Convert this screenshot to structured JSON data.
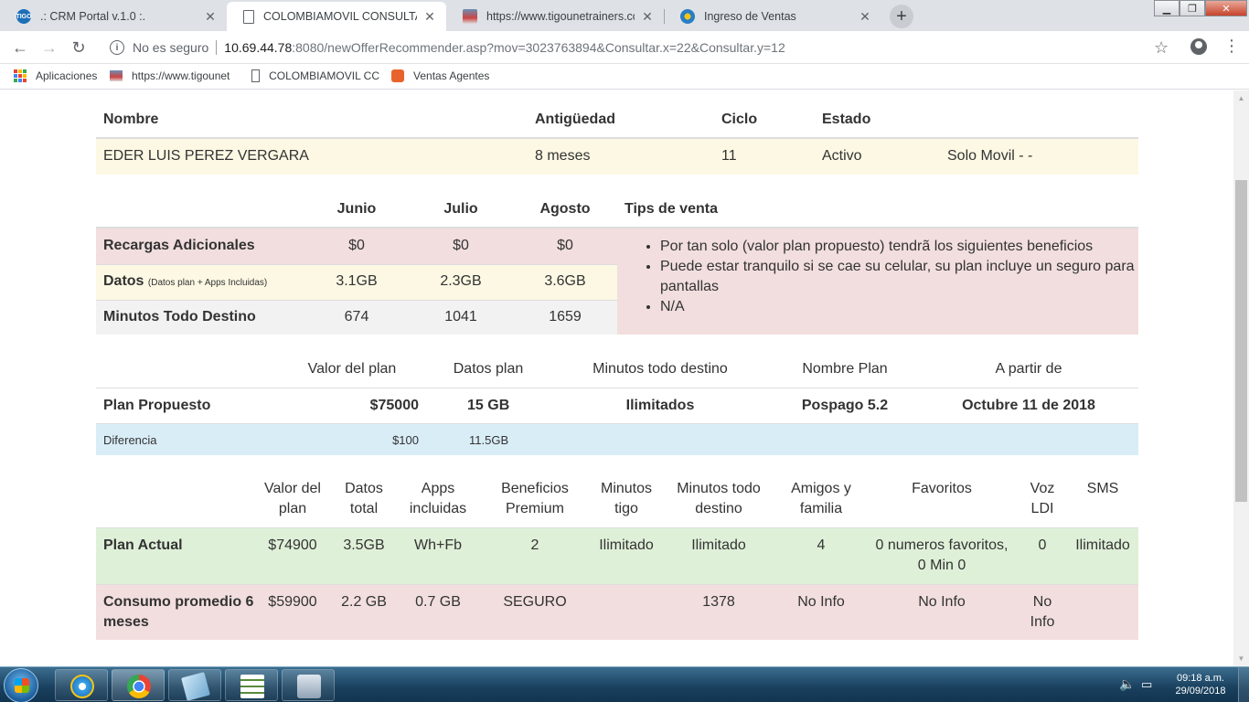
{
  "browser": {
    "tabs": [
      {
        "title": ".: CRM Portal v.1.0 :.",
        "favicon": "tigo-favicon",
        "active": false
      },
      {
        "title": "COLOMBIAMOVIL CONSULTA IN",
        "favicon": "document-icon",
        "active": true
      },
      {
        "title": "https://www.tigounetrainers.com",
        "favicon": "tigoune-favicon",
        "active": false
      },
      {
        "title": "Ingreso de Ventas",
        "favicon": "globe-favicon",
        "active": false
      }
    ],
    "tab_close": "✕",
    "new_tab": "+",
    "security_label": "No es seguro",
    "url_host": "10.69.44.78",
    "url_rest": ":8080/newOfferRecommender.asp?mov=3023763894&Consultar.x=22&Consultar.y=12",
    "bookmarks": [
      {
        "label": "Aplicaciones",
        "icon": "apps-icon"
      },
      {
        "label": "https://www.tigounet",
        "icon": "tigoune-favicon"
      },
      {
        "label": "COLOMBIAMOVIL CC",
        "icon": "document-icon"
      },
      {
        "label": "Ventas Agentes",
        "icon": "xampp-icon"
      }
    ]
  },
  "customer": {
    "headers": {
      "nombre": "Nombre",
      "antiguedad": "Antigüedad",
      "ciclo": "Ciclo",
      "estado": "Estado"
    },
    "nombre": "EDER LUIS PEREZ VERGARA",
    "antiguedad": "8 meses",
    "ciclo": "11",
    "estado": "Activo",
    "tipo": "Solo Movil - -"
  },
  "consumption": {
    "months": [
      "Junio",
      "Julio",
      "Agosto"
    ],
    "tips_header": "Tips de venta",
    "rows": [
      {
        "label": "Recargas Adicionales",
        "note": "",
        "values": [
          "$0",
          "$0",
          "$0"
        ]
      },
      {
        "label": "Datos",
        "note": "(Datos plan + Apps Incluidas)",
        "values": [
          "3.1GB",
          "2.3GB",
          "3.6GB"
        ]
      },
      {
        "label": "Minutos Todo Destino",
        "note": "",
        "values": [
          "674",
          "1041",
          "1659"
        ]
      }
    ],
    "tips": [
      "Por tan solo (valor plan propuesto) tendrã los siguientes beneficios",
      "Puede estar tranquilo si se cae su celular, su plan incluye un seguro para pantallas",
      "N/A"
    ]
  },
  "proposed": {
    "headers": [
      "Valor del plan",
      "Datos plan",
      "Minutos todo destino",
      "Nombre Plan",
      "A partir de"
    ],
    "label": "Plan Propuesto",
    "valor": "$75000",
    "datos": "15 GB",
    "minutos": "Ilimitados",
    "nombre_plan": "Pospago 5.2",
    "a_partir": "Octubre 11 de 2018",
    "diff_label": "Diferencia",
    "diff_valor": "$100",
    "diff_datos": "11.5GB"
  },
  "current": {
    "headers": [
      "Valor del plan",
      "Datos total",
      "Apps incluidas",
      "Beneficios Premium",
      "Minutos tigo",
      "Minutos todo destino",
      "Amigos y familia",
      "Favoritos",
      "Voz LDI",
      "SMS"
    ],
    "plan_actual": {
      "label": "Plan Actual",
      "values": [
        "$74900",
        "3.5GB",
        "Wh+Fb",
        "2",
        "Ilimitado",
        "Ilimitado",
        "4",
        "0 numeros favoritos, 0 Min 0",
        "0",
        "Ilimitado"
      ]
    },
    "consumo": {
      "label": "Consumo promedio 6 meses",
      "values": [
        "$59900",
        "2.2 GB",
        "0.7 GB",
        "SEGURO",
        "",
        "1378",
        "No Info",
        "No Info",
        "No Info",
        ""
      ]
    }
  },
  "taskbar": {
    "apps": [
      "internet-explorer-icon",
      "chrome-icon",
      "notepad-icon",
      "calculator-grid-icon",
      "calculator-icon"
    ],
    "time": "09:18 a.m.",
    "date": "29/09/2018"
  }
}
